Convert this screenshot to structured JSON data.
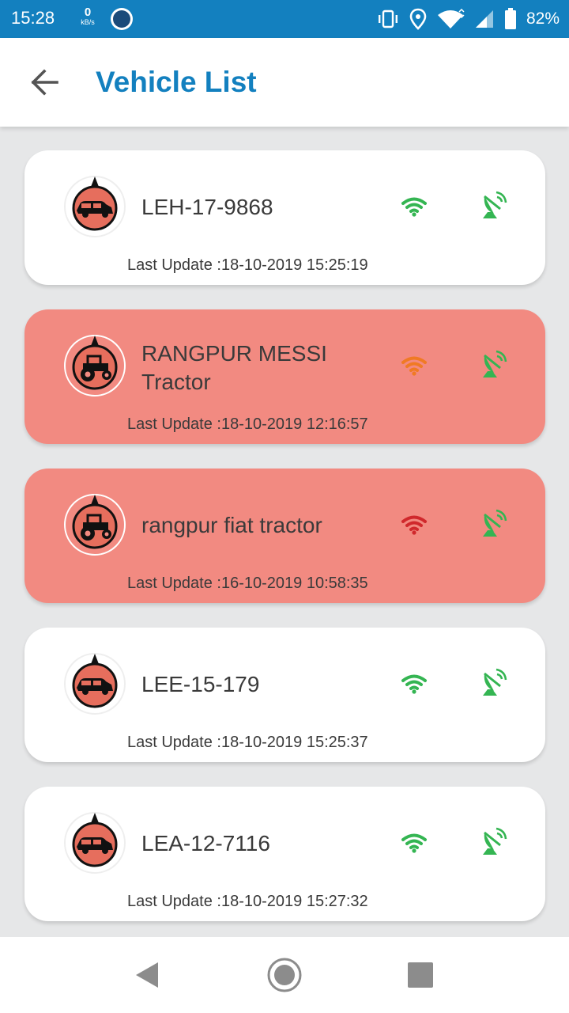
{
  "status_bar": {
    "time": "15:28",
    "net_speed_value": "0",
    "net_speed_unit": "kB/s",
    "battery": "82%",
    "icons": [
      "vibrate-icon",
      "location-icon",
      "wifi-icon",
      "signal-icon",
      "battery-icon"
    ]
  },
  "header": {
    "title": "Vehicle List",
    "back_icon": "arrow-left-icon"
  },
  "colors": {
    "primary": "#1380bf",
    "offline_card": "#f28a81",
    "signal_good": "#34b552",
    "signal_weak": "#f07a24",
    "signal_lost": "#d0282c"
  },
  "vehicles": [
    {
      "name": "LEH-17-9868",
      "type": "car",
      "last_update": "Last Update :18-10-2019 15:25:19",
      "signal": "good",
      "status": "online"
    },
    {
      "name": "RANGPUR MESSI\nTractor",
      "type": "tractor",
      "last_update": "Last Update :18-10-2019 12:16:57",
      "signal": "weak",
      "status": "offline"
    },
    {
      "name": "rangpur fiat tractor",
      "type": "tractor",
      "last_update": "Last Update :16-10-2019 10:58:35",
      "signal": "lost",
      "status": "offline"
    },
    {
      "name": "LEE-15-179",
      "type": "car",
      "last_update": "Last Update :18-10-2019 15:25:37",
      "signal": "good",
      "status": "online"
    },
    {
      "name": "LEA-12-7116",
      "type": "car",
      "last_update": "Last Update :18-10-2019 15:27:32",
      "signal": "good",
      "status": "online"
    }
  ],
  "nav": {
    "back": "back-triangle-icon",
    "home": "home-circle-icon",
    "recents": "recents-square-icon"
  }
}
